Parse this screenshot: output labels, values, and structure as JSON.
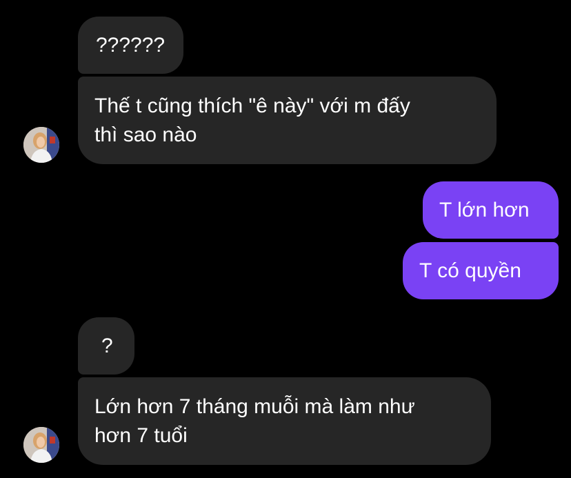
{
  "chat": {
    "messages": [
      {
        "sender": "them",
        "text": "??????"
      },
      {
        "sender": "them",
        "text": "Thế t cũng thích \"ê này\" với m đấy\nthì sao nào"
      },
      {
        "sender": "me",
        "text": "T lớn hơn"
      },
      {
        "sender": "me",
        "text": "T có quyền"
      },
      {
        "sender": "them",
        "text": "?"
      },
      {
        "sender": "them",
        "text": "Lớn hơn 7 tháng muỗi mà làm như\nhơn 7 tuổi"
      }
    ],
    "colors": {
      "background": "#000000",
      "incoming_bubble": "#262626",
      "outgoing_bubble": "#7a42f4",
      "text": "#ffffff"
    },
    "avatar_icon": "profile-photo"
  }
}
